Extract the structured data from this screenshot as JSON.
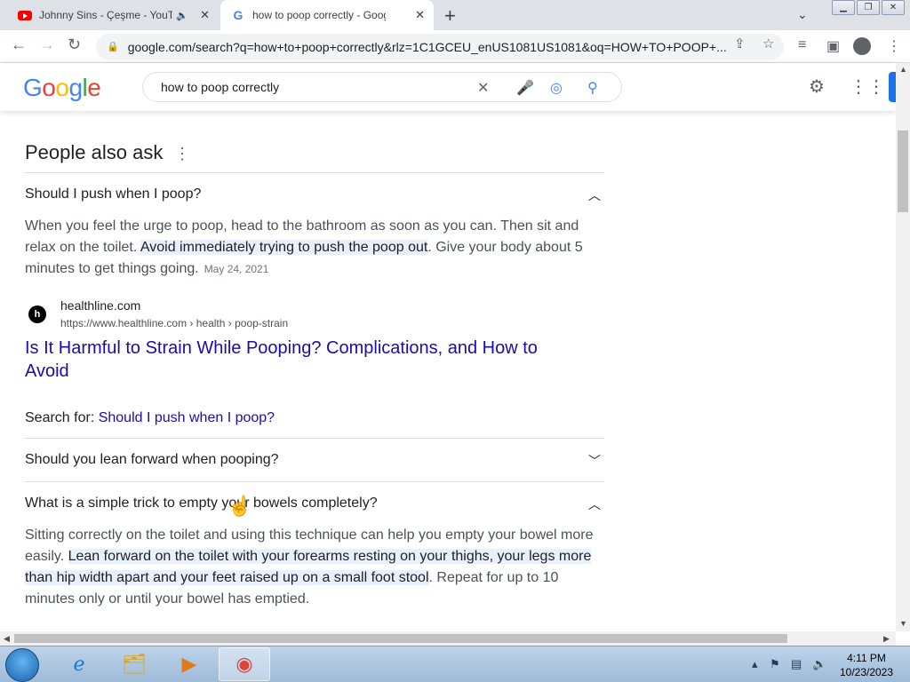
{
  "browser": {
    "tabs": [
      {
        "title": "Johnny Sins - Çeşme - YouTu",
        "muted_icon": "speaker-icon"
      },
      {
        "title": "how to poop correctly - Google S"
      }
    ],
    "url": "google.com/search?q=how+to+poop+correctly&rlz=1C1GCEU_enUS1081US1081&oq=HOW+TO+POOP+..."
  },
  "google": {
    "logo": "Google",
    "query": "how to poop correctly"
  },
  "paa": {
    "title": "People also ask",
    "q1": {
      "question": "Should I push when I poop?",
      "answer_pre": "When you feel the urge to poop, head to the bathroom as soon as you can. Then sit and relax on the toilet. ",
      "answer_hl": "Avoid immediately trying to push the poop out",
      "answer_post": ". Give your body about 5 minutes to get things going.",
      "date": "May 24, 2021",
      "favicon_text": "h",
      "site": "healthline.com",
      "cite": "https://www.healthline.com › health › poop-strain",
      "link": "Is It Harmful to Strain While Pooping? Complications, and How to Avoid",
      "search_for_label": "Search for: ",
      "search_for_link": "Should I push when I poop?"
    },
    "q2": {
      "question": "Should you lean forward when pooping?"
    },
    "q3": {
      "question": "What is a simple trick to empty your bowels completely?",
      "answer_pre": "Sitting correctly on the toilet and using this technique can help you empty your bowel more easily. ",
      "answer_hl": "Lean forward on the toilet with your forearms resting on your thighs, your legs more than hip width apart and your feet raised up on a small foot stool",
      "answer_post": ". Repeat for up to 10 minutes only or until your bowel has emptied."
    }
  },
  "taskbar": {
    "time": "4:11 PM",
    "date": "10/23/2023"
  },
  "colors": {
    "link": "#1a0dab",
    "highlight": "#e8f0fe",
    "accent": "#1a73e8"
  }
}
